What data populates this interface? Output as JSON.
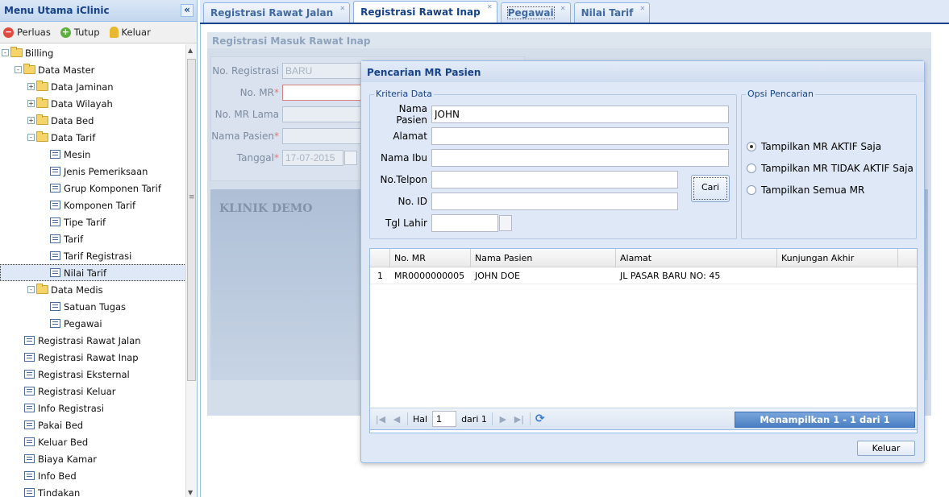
{
  "sidebar": {
    "title": "Menu Utama iClinic",
    "collapse_glyph": "«",
    "toolbar": {
      "perluas": "Perluas",
      "tutup": "Tutup",
      "keluar": "Keluar"
    },
    "tree": [
      {
        "label": "Billing",
        "type": "folder",
        "expander": "-"
      },
      {
        "label": "Data Master",
        "type": "folder",
        "expander": "-"
      },
      {
        "label": "Data Jaminan",
        "type": "folder",
        "expander": "+"
      },
      {
        "label": "Data Wilayah",
        "type": "folder",
        "expander": "+"
      },
      {
        "label": "Data Bed",
        "type": "folder",
        "expander": "+"
      },
      {
        "label": "Data Tarif",
        "type": "folder",
        "expander": "-"
      },
      {
        "label": "Mesin",
        "type": "leaf"
      },
      {
        "label": "Jenis Pemeriksaan",
        "type": "leaf"
      },
      {
        "label": "Grup Komponen Tarif",
        "type": "leaf"
      },
      {
        "label": "Komponen Tarif",
        "type": "leaf"
      },
      {
        "label": "Tipe Tarif",
        "type": "leaf"
      },
      {
        "label": "Tarif",
        "type": "leaf"
      },
      {
        "label": "Tarif Registrasi",
        "type": "leaf"
      },
      {
        "label": "Nilai Tarif",
        "type": "leaf",
        "selected": true
      },
      {
        "label": "Data Medis",
        "type": "folder",
        "expander": "-"
      },
      {
        "label": "Satuan Tugas",
        "type": "leaf"
      },
      {
        "label": "Pegawai",
        "type": "leaf"
      },
      {
        "label": "Registrasi Rawat Jalan",
        "type": "leaf"
      },
      {
        "label": "Registrasi Rawat Inap",
        "type": "leaf"
      },
      {
        "label": "Registrasi Eksternal",
        "type": "leaf"
      },
      {
        "label": "Registrasi Keluar",
        "type": "leaf"
      },
      {
        "label": "Info Registrasi",
        "type": "leaf"
      },
      {
        "label": "Pakai Bed",
        "type": "leaf"
      },
      {
        "label": "Keluar Bed",
        "type": "leaf"
      },
      {
        "label": "Biaya Kamar",
        "type": "leaf"
      },
      {
        "label": "Info Bed",
        "type": "leaf"
      },
      {
        "label": "Tindakan",
        "type": "leaf"
      }
    ]
  },
  "tabs": [
    {
      "label": "Registrasi Rawat Jalan"
    },
    {
      "label": "Registrasi Rawat Inap",
      "active": true
    },
    {
      "label": "Pegawai"
    },
    {
      "label": "Nilai Tarif"
    }
  ],
  "registration": {
    "title": "Registrasi Masuk Rawat Inap",
    "no_registrasi_label": "No. Registrasi",
    "no_registrasi_value": "BARU",
    "no_mr_label": "No. MR",
    "no_mr_lama_label": "No. MR Lama",
    "nama_pasien_label": "Nama Pasien",
    "tanggal_label": "Tanggal",
    "tanggal_value": "17-07-2015",
    "required_mark": "*",
    "banner": "KLINIK DEMO"
  },
  "dialog": {
    "title": "Pencarian MR Pasien",
    "kriteria_legend": "Kriteria Data",
    "opsi_legend": "Opsi Pencarian",
    "fields": {
      "nama_pasien": {
        "label": "Nama Pasien",
        "value": "JOHN"
      },
      "alamat": {
        "label": "Alamat",
        "value": ""
      },
      "nama_ibu": {
        "label": "Nama Ibu",
        "value": ""
      },
      "no_telpon": {
        "label": "No.Telpon",
        "value": ""
      },
      "no_id": {
        "label": "No. ID",
        "value": ""
      },
      "tgl_lahir": {
        "label": "Tgl Lahir",
        "value": ""
      }
    },
    "cari_button": "Cari",
    "options": [
      {
        "label": "Tampilkan MR AKTIF Saja",
        "checked": true
      },
      {
        "label": "Tampilkan MR TIDAK AKTIF Saja",
        "checked": false
      },
      {
        "label": "Tampilkan Semua MR",
        "checked": false
      }
    ],
    "grid": {
      "columns": [
        "No. MR",
        "Nama Pasien",
        "Alamat",
        "Kunjungan Akhir"
      ],
      "rows": [
        {
          "num": "1",
          "no_mr": "MR0000000005",
          "nama": "JOHN DOE",
          "alamat": "JL PASAR BARU NO: 45",
          "kunjungan": ""
        }
      ]
    },
    "pager": {
      "hal_label": "Hal",
      "page": "1",
      "of_label": "dari 1",
      "status": "Menampilkan 1 - 1 dari 1"
    },
    "keluar_button": "Keluar"
  }
}
